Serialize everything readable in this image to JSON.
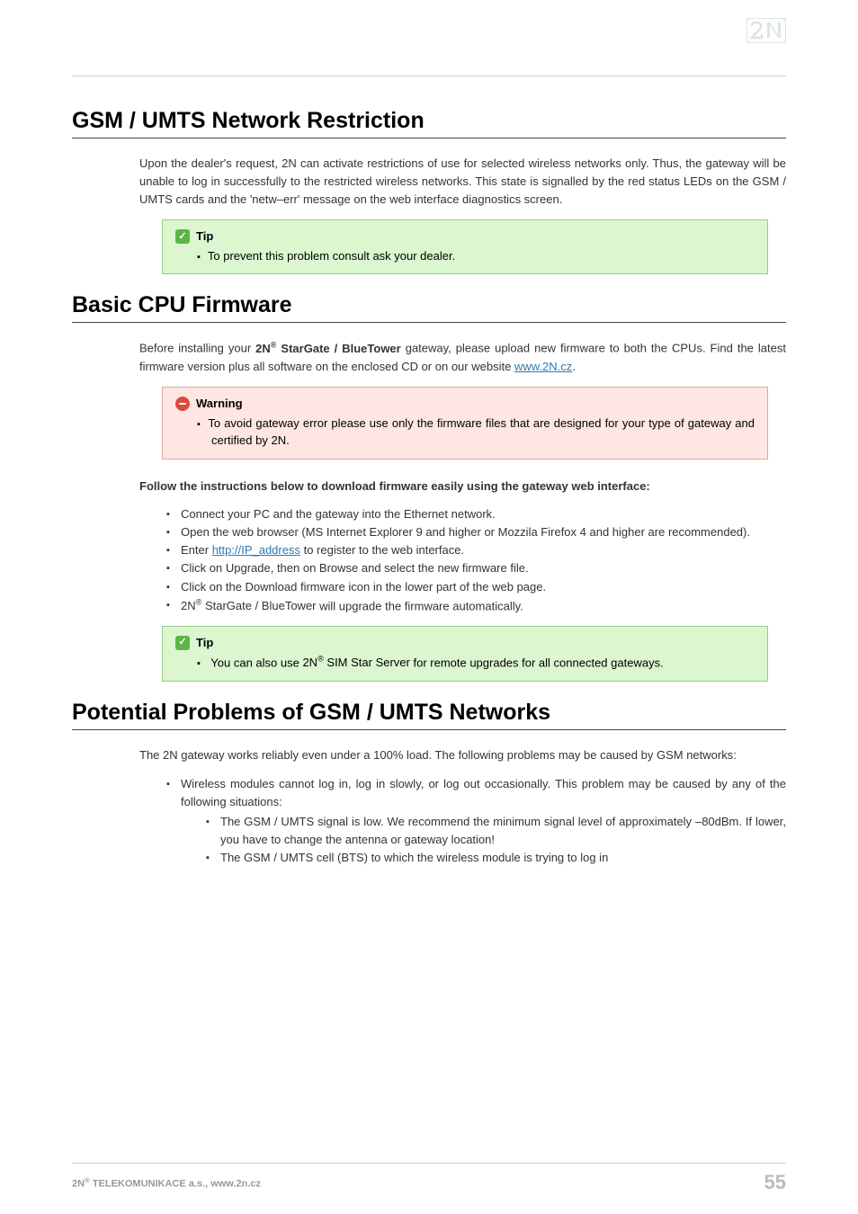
{
  "logo_alt": "2N",
  "sections": [
    {
      "heading": "GSM / UMTS Network Restriction",
      "paragraph": "Upon the dealer's request, 2N can activate restrictions of use for selected wireless networks only. Thus, the gateway will be unable to log in successfully to the restricted wireless networks. This state is signalled by the red status LEDs on the GSM / UMTS cards and the 'netw–err' message on the web interface diagnostics screen."
    },
    {
      "callout_tip": {
        "title": "Tip",
        "item": "To prevent this problem consult ask your dealer."
      }
    },
    {
      "heading2": "Basic CPU Firmware",
      "para2_pre": "Before installing your ",
      "para2_bold": "2N",
      "para2_sup": "®",
      "para2_bold2": " StarGate / BlueTower",
      "para2_post": " gateway, please upload new firmware to both the CPUs. Find the latest firmware version plus all software on the enclosed CD or on our website ",
      "para2_link": "www.2N.cz",
      "para2_end": "."
    },
    {
      "callout_warning": {
        "title": "Warning",
        "item": "To avoid gateway error please use only the firmware files that are designed for your type of gateway and certified by 2N."
      }
    },
    {
      "sub_bold": "Follow the instructions below to download firmware easily using the gateway web interface:",
      "steps": [
        {
          "text": "Connect your PC and the gateway into the Ethernet network."
        },
        {
          "text": "Open the web browser (MS Internet Explorer 9 and higher or Mozzila Firefox 4 and higher are recommended)."
        },
        {
          "pre": "Enter ",
          "link": "http://IP_address",
          "post": " to register to the web interface."
        },
        {
          "text": "Click on Upgrade, then on Browse and select the new firmware file."
        },
        {
          "text": "Click on the Download firmware icon in the lower part of the web page."
        },
        {
          "bold": "2N",
          "sup": "®",
          "bold2": " StarGate / BlueTower",
          "post": " will upgrade the firmware automatically."
        }
      ]
    },
    {
      "callout_tip2": {
        "title": "Tip",
        "pre": "You can also use ",
        "bold": "2N",
        "sup": "®",
        "bold2": " SIM Star Server",
        "post": " for remote upgrades for all connected gateways."
      }
    },
    {
      "heading3": "Potential Problems of GSM / UMTS Networks",
      "para3": "The 2N gateway works reliably even under a 100% load. The following problems may be caused by GSM networks:",
      "problem_title": "Wireless modules cannot log in, log in slowly, or log out occasionally. This problem may be caused by any of the following situations:",
      "sub_items": [
        "The GSM / UMTS signal is low. We recommend the minimum signal level of approximately –80dBm. If lower, you have to change the antenna or gateway location!",
        "The GSM / UMTS cell (BTS) to which the wireless module is trying to log in"
      ]
    }
  ],
  "footer": {
    "left_pre": "2N",
    "left_sup": "®",
    "left_post": " TELEKOMUNIKACE a.s., www.2n.cz",
    "page": "55"
  }
}
